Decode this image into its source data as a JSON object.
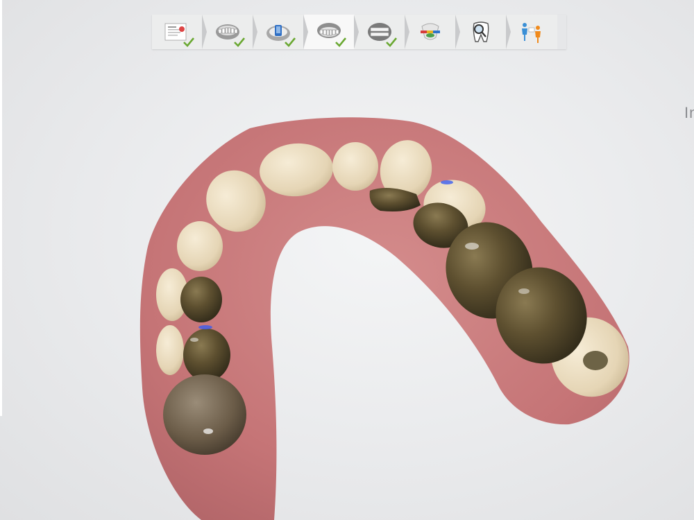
{
  "app": {
    "right_edge_text": "In"
  },
  "workflow_steps": [
    {
      "name": "patient-details",
      "icon": "document-icon",
      "completed": true,
      "active": false
    },
    {
      "name": "scan-upper-jaw",
      "icon": "upper-jaw-icon",
      "completed": true,
      "active": false
    },
    {
      "name": "scan-preparation",
      "icon": "preparation-scan-icon",
      "completed": true,
      "active": false
    },
    {
      "name": "scan-lower-jaw",
      "icon": "lower-jaw-icon",
      "completed": true,
      "active": true
    },
    {
      "name": "bite-registration",
      "icon": "bite-icon",
      "completed": true,
      "active": false
    },
    {
      "name": "analysis",
      "icon": "occlusion-analysis-icon",
      "completed": false,
      "active": false
    },
    {
      "name": "inspect",
      "icon": "tooth-magnifier-icon",
      "completed": false,
      "active": false
    },
    {
      "name": "send-to-lab",
      "icon": "send-to-lab-icon",
      "completed": false,
      "active": false
    }
  ],
  "colors": {
    "check_green": "#6aa832",
    "gum": "#c8787a",
    "metal_crown": "#5e5030",
    "natural_tooth": "#e8dcc0"
  },
  "viewport": {
    "content": "lower-jaw-3d-scan"
  }
}
